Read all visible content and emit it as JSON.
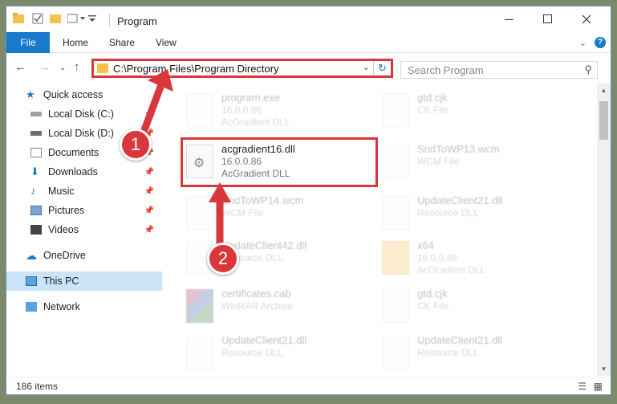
{
  "window": {
    "title": "Program"
  },
  "ribbon": {
    "tabs": [
      "File",
      "Home",
      "Share",
      "View"
    ]
  },
  "nav": {
    "address": "C:\\Program Files\\Program Directory",
    "search_placeholder": "Search Program"
  },
  "sidebar": {
    "items": [
      {
        "label": "Quick access"
      },
      {
        "label": "Local Disk (C:)"
      },
      {
        "label": "Local Disk (D:)"
      },
      {
        "label": "Documents"
      },
      {
        "label": "Downloads"
      },
      {
        "label": "Music"
      },
      {
        "label": "Pictures"
      },
      {
        "label": "Videos"
      },
      {
        "label": "OneDrive"
      },
      {
        "label": "This PC"
      },
      {
        "label": "Network"
      }
    ]
  },
  "files": {
    "left": [
      {
        "name": "program.exe",
        "line2": "16.0.0.86",
        "line3": "AcGradient DLL"
      },
      {
        "name": "acgradient16.dll",
        "line2": "16.0.0.86",
        "line3": "AcGradient DLL"
      },
      {
        "name": "SndToWP14.wcm",
        "line2": "WCM File",
        "line3": ""
      },
      {
        "name": "UpdateClient42.dll",
        "line2": "Resource DLL",
        "line3": ""
      },
      {
        "name": "certificates.cab",
        "line2": "WinRAR Archive",
        "line3": ""
      },
      {
        "name": "UpdateClient21.dll",
        "line2": "Resource DLL",
        "line3": ""
      }
    ],
    "right": [
      {
        "name": "gtd.cjk",
        "line2": "CK File",
        "line3": ""
      },
      {
        "name": "SndToWP13.wcm",
        "line2": "WCM File",
        "line3": ""
      },
      {
        "name": "UpdateClient21.dll",
        "line2": "Resource DLL",
        "line3": ""
      },
      {
        "name": "x64",
        "line2": "16.0.0.86",
        "line3": "AcGradient DLL"
      },
      {
        "name": "gtd.cjk",
        "line2": "CK File",
        "line3": ""
      },
      {
        "name": "UpdateClient21.dll",
        "line2": "Resource DLL",
        "line3": ""
      }
    ]
  },
  "status": {
    "count": "186 items"
  },
  "annotations": {
    "step1": "1",
    "step2": "2"
  },
  "colors": {
    "accent": "#1979ca",
    "highlight": "#d9373b"
  }
}
